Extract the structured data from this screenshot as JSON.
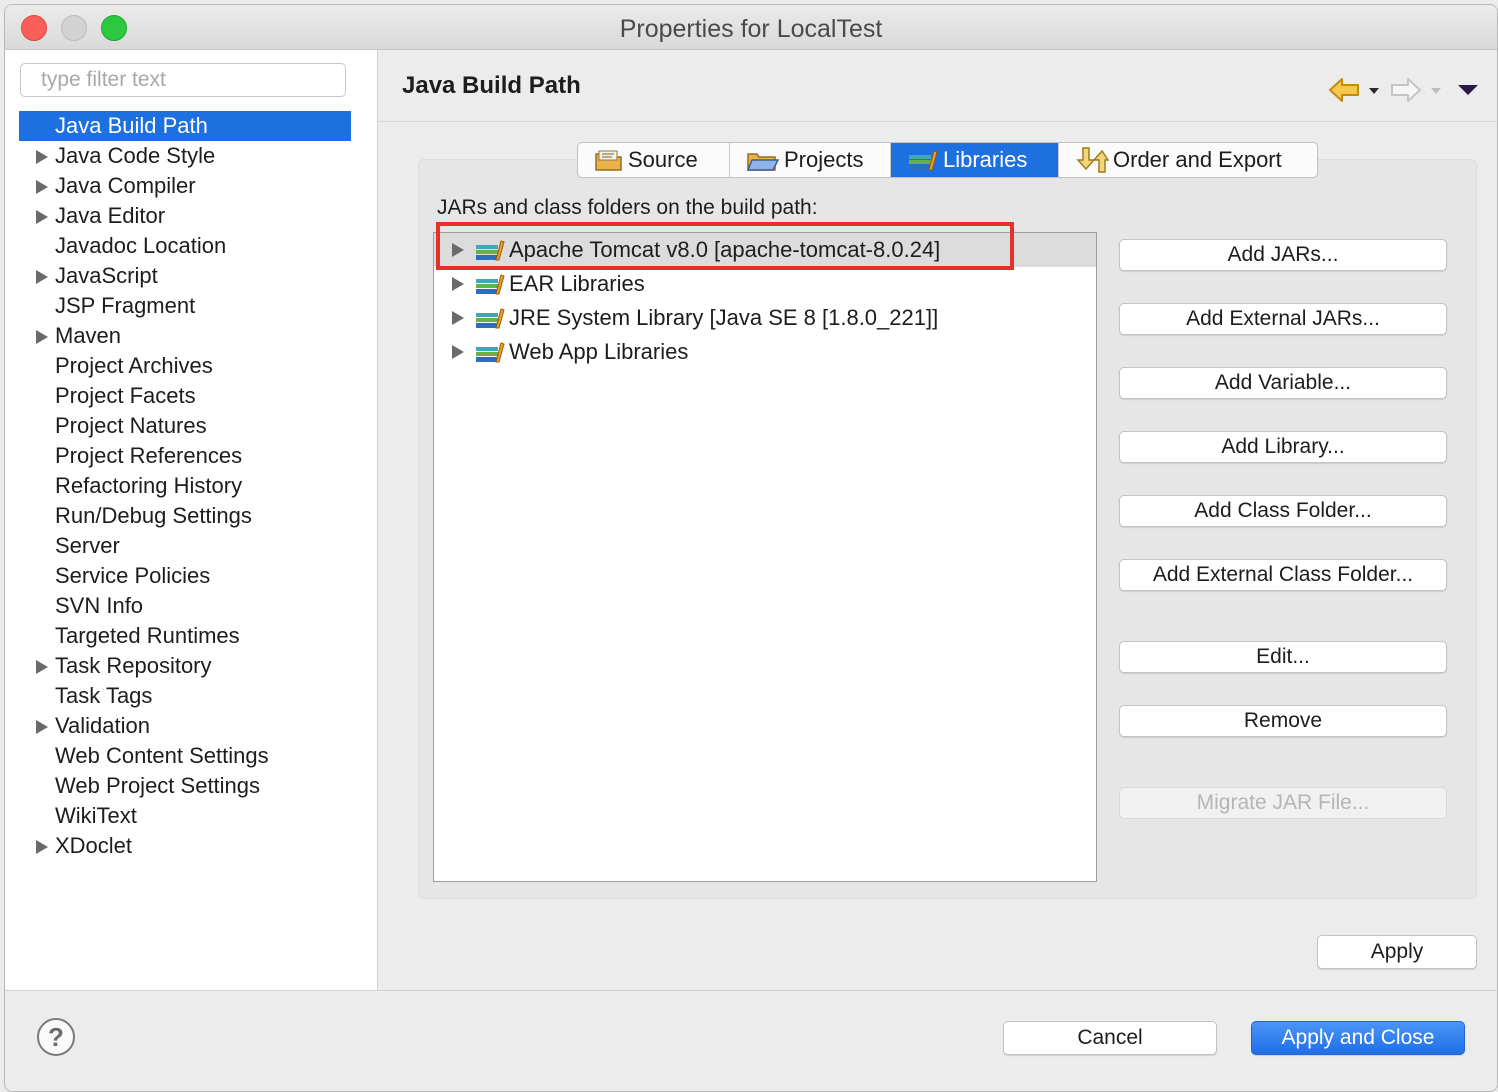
{
  "window": {
    "title": "Properties for LocalTest"
  },
  "sidebar": {
    "filter_placeholder": "type filter text",
    "items": [
      {
        "label": "Java Build Path",
        "expandable": false,
        "selected": true
      },
      {
        "label": "Java Code Style",
        "expandable": true
      },
      {
        "label": "Java Compiler",
        "expandable": true
      },
      {
        "label": "Java Editor",
        "expandable": true
      },
      {
        "label": "Javadoc Location",
        "expandable": false
      },
      {
        "label": "JavaScript",
        "expandable": true
      },
      {
        "label": "JSP Fragment",
        "expandable": false
      },
      {
        "label": "Maven",
        "expandable": true
      },
      {
        "label": "Project Archives",
        "expandable": false
      },
      {
        "label": "Project Facets",
        "expandable": false
      },
      {
        "label": "Project Natures",
        "expandable": false
      },
      {
        "label": "Project References",
        "expandable": false
      },
      {
        "label": "Refactoring History",
        "expandable": false
      },
      {
        "label": "Run/Debug Settings",
        "expandable": false
      },
      {
        "label": "Server",
        "expandable": false
      },
      {
        "label": "Service Policies",
        "expandable": false
      },
      {
        "label": "SVN Info",
        "expandable": false
      },
      {
        "label": "Targeted Runtimes",
        "expandable": false
      },
      {
        "label": "Task Repository",
        "expandable": true
      },
      {
        "label": "Task Tags",
        "expandable": false
      },
      {
        "label": "Validation",
        "expandable": true
      },
      {
        "label": "Web Content Settings",
        "expandable": false
      },
      {
        "label": "Web Project Settings",
        "expandable": false
      },
      {
        "label": "WikiText",
        "expandable": false
      },
      {
        "label": "XDoclet",
        "expandable": true
      }
    ]
  },
  "page": {
    "title": "Java Build Path",
    "tabs": [
      {
        "label": "Source",
        "icon": "source-folder-icon"
      },
      {
        "label": "Projects",
        "icon": "projects-folder-icon"
      },
      {
        "label": "Libraries",
        "icon": "libraries-icon",
        "active": true
      },
      {
        "label": "Order and Export",
        "icon": "order-export-icon"
      }
    ],
    "list_label": "JARs and class folders on the build path:",
    "libraries": [
      {
        "label": "Apache Tomcat v8.0 [apache-tomcat-8.0.24]",
        "highlighted": true
      },
      {
        "label": "EAR Libraries"
      },
      {
        "label": "JRE System Library [Java SE 8 [1.8.0_221]]"
      },
      {
        "label": "Web App Libraries"
      }
    ],
    "buttons": {
      "add_jars": "Add JARs...",
      "add_external_jars": "Add External JARs...",
      "add_variable": "Add Variable...",
      "add_library": "Add Library...",
      "add_class_folder": "Add Class Folder...",
      "add_external_class_folder": "Add External Class Folder...",
      "edit": "Edit...",
      "remove": "Remove",
      "migrate_jar": "Migrate JAR File..."
    },
    "apply": "Apply"
  },
  "footer": {
    "help": "?",
    "cancel": "Cancel",
    "apply_and_close": "Apply and Close"
  },
  "colors": {
    "selection": "#1e6fe0",
    "annotation_red": "#e5312a",
    "primary_button": "#1f6fe6"
  }
}
